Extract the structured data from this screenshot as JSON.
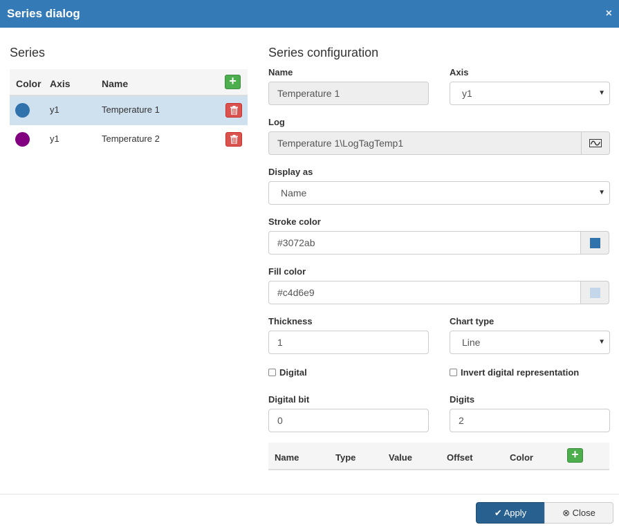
{
  "dialog": {
    "title": "Series dialog",
    "close_glyph": "×"
  },
  "series_panel": {
    "title": "Series",
    "headers": {
      "color": "Color",
      "axis": "Axis",
      "name": "Name"
    },
    "add_glyph": "+",
    "rows": [
      {
        "color": "#3072ab",
        "axis": "y1",
        "name": "Temperature 1"
      },
      {
        "color": "#800080",
        "axis": "y1",
        "name": "Temperature 2"
      }
    ]
  },
  "config": {
    "title": "Series configuration",
    "name": {
      "label": "Name",
      "value": "Temperature 1"
    },
    "axis": {
      "label": "Axis",
      "value": "y1"
    },
    "log": {
      "label": "Log",
      "value": "Temperature 1\\LogTagTemp1",
      "icon": "trend-icon"
    },
    "display_as": {
      "label": "Display as",
      "value": "Name"
    },
    "stroke_color": {
      "label": "Stroke color",
      "value": "#3072ab"
    },
    "fill_color": {
      "label": "Fill color",
      "value": "#c4d6e9"
    },
    "thickness": {
      "label": "Thickness",
      "value": "1"
    },
    "chart_type": {
      "label": "Chart type",
      "value": "Line"
    },
    "digital": {
      "label": "Digital",
      "checked": false
    },
    "invert_digital": {
      "label": "Invert digital representation",
      "checked": false
    },
    "digital_bit": {
      "label": "Digital bit",
      "value": "0"
    },
    "digits": {
      "label": "Digits",
      "value": "2"
    },
    "ranges_table": {
      "headers": {
        "name": "Name",
        "type": "Type",
        "value": "Value",
        "offset": "Offset",
        "color": "Color"
      },
      "add_glyph": "+"
    }
  },
  "footer": {
    "apply_label": "Apply",
    "close_label": "Close"
  },
  "colors": {
    "header": "#337ab7",
    "selected_row": "#cfe0ef",
    "primary": "#286090",
    "success": "#4cae4c",
    "danger": "#d9534f"
  }
}
